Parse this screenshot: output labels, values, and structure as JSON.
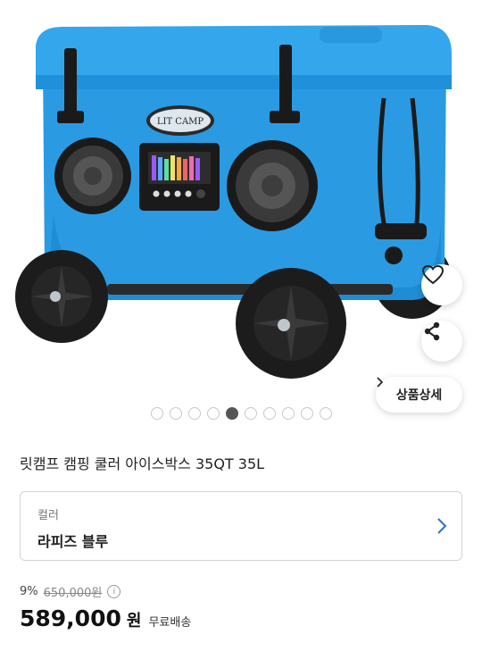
{
  "product_image": {
    "brand_logo_text": "LIT CAMP",
    "total_images": 10,
    "active_index": 4,
    "colors": {
      "body": "#2a9be2",
      "accent": "#1b82c9",
      "wheel": "#1c1c1c"
    }
  },
  "actions": {
    "wishlist_icon": "heart-icon",
    "share_icon": "share-icon",
    "detail_label": "상품상세"
  },
  "product": {
    "title": "릿캠프 캠핑 쿨러 아이스박스 35QT 35L",
    "option": {
      "label": "컬러",
      "value": "라피즈 블루"
    },
    "discount": "9%",
    "original_price": "650,000원",
    "final_price": "589,000",
    "currency": "원",
    "shipping": "무료배송"
  }
}
